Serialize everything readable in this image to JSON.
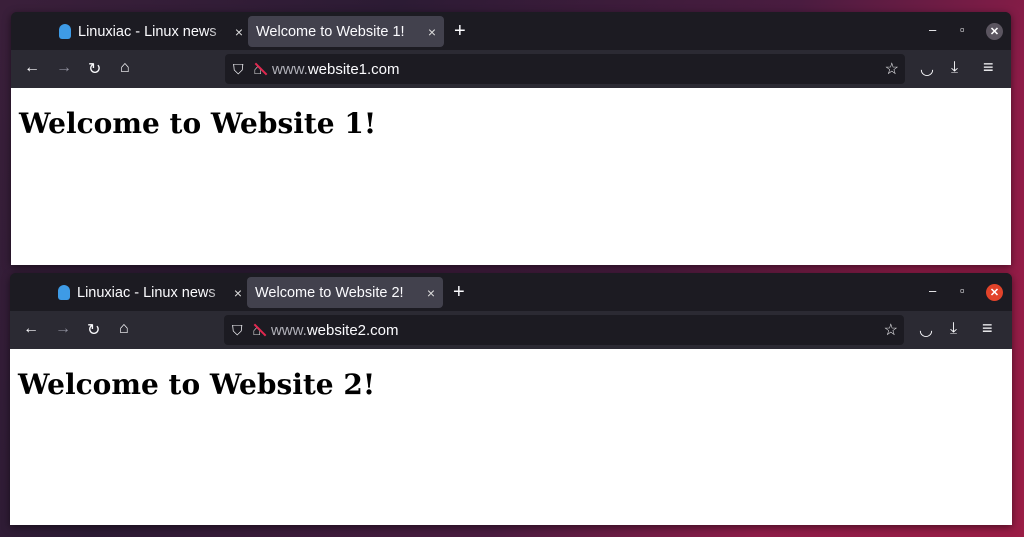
{
  "windows": [
    {
      "tabs": [
        {
          "title": "Linuxiac - Linux news",
          "active": false
        },
        {
          "title": "Welcome to Website 1!",
          "active": true
        }
      ],
      "url_prefix": "www.",
      "url_domain": "website1.com",
      "heading": "Welcome to Website 1!",
      "close_color": "#5b5560"
    },
    {
      "tabs": [
        {
          "title": "Linuxiac - Linux news",
          "active": false
        },
        {
          "title": "Welcome to Website 2!",
          "active": true
        }
      ],
      "url_prefix": "www.",
      "url_domain": "website2.com",
      "heading": "Welcome to Website 2!",
      "close_color": "#e2432a"
    }
  ],
  "icons": {
    "tab_close": "×",
    "new_tab": "+",
    "minimize": "–",
    "maximize": "▫",
    "close": "✕",
    "back": "←",
    "forward": "→",
    "reload": "↻",
    "home": "⌂",
    "shield": "⛉",
    "lock": "🔓",
    "star": "☆",
    "pocket": "◡",
    "download": "⤓",
    "menu": "≡"
  }
}
